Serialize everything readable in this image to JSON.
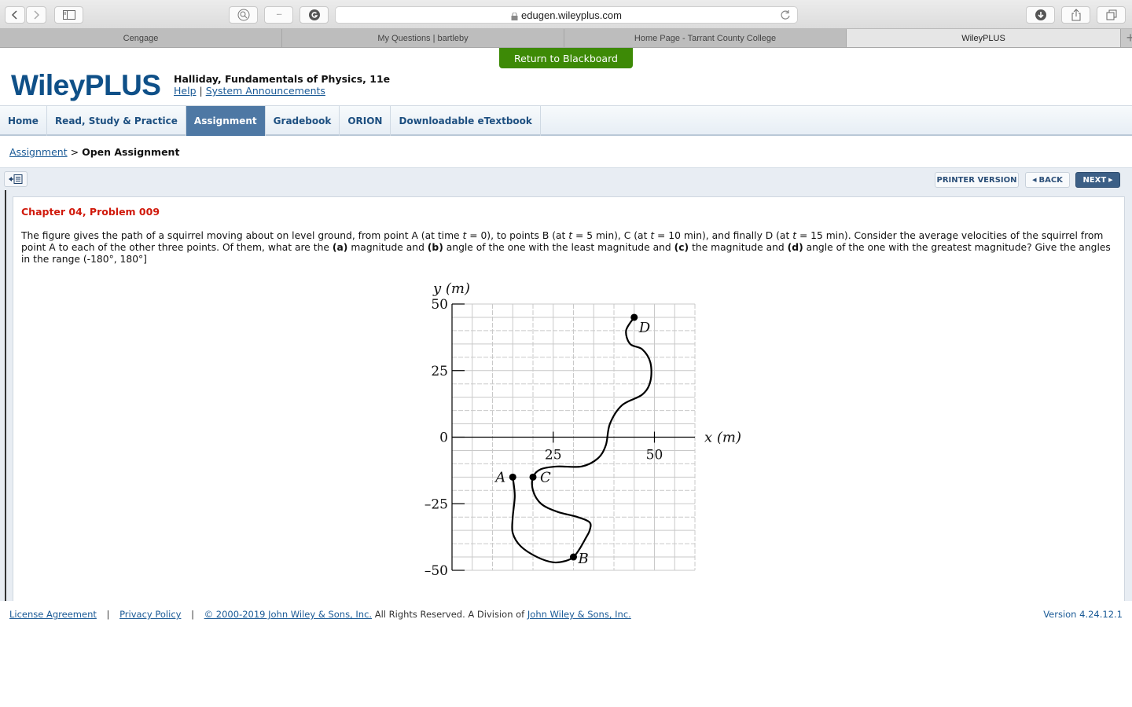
{
  "browser": {
    "url": "edugen.wileyplus.com",
    "tabs": [
      {
        "label": "Cengage",
        "active": false
      },
      {
        "label": "My Questions | bartleby",
        "active": false
      },
      {
        "label": "Home Page - Tarrant County College",
        "active": false
      },
      {
        "label": "WileyPLUS",
        "active": true
      }
    ],
    "new_tab_label": "+",
    "more_label": "···"
  },
  "page": {
    "return_button": "Return to Blackboard",
    "logo": "WileyPLUS",
    "course_title": "Halliday, Fundamentals of Physics, 11e",
    "help_link": "Help",
    "help_sep": "|",
    "announcements_link": "System Announcements",
    "nav": [
      {
        "label": "Home",
        "active": false
      },
      {
        "label": "Read, Study & Practice",
        "active": false
      },
      {
        "label": "Assignment",
        "active": true
      },
      {
        "label": "Gradebook",
        "active": false
      },
      {
        "label": "ORION",
        "active": false
      },
      {
        "label": "Downloadable eTextbook",
        "active": false
      }
    ],
    "breadcrumb": {
      "link": "Assignment",
      "sep": ">",
      "current": "Open Assignment"
    },
    "actions": {
      "printer": "PRINTER VERSION",
      "back": "BACK",
      "next": "NEXT"
    },
    "problem": {
      "title": "Chapter 04, Problem 009",
      "text_parts": [
        {
          "t": "The figure gives the path of a squirrel moving about on level ground, from point A (at time "
        },
        {
          "i": "t"
        },
        {
          "t": " = 0), to points B (at "
        },
        {
          "i": "t"
        },
        {
          "t": " = 5 min), C (at "
        },
        {
          "i": "t"
        },
        {
          "t": " = 10 min), and finally D (at "
        },
        {
          "i": "t"
        },
        {
          "t": " = 15 min). Consider the average velocities of the squirrel from point A to each of the other three points. Of them, what are the "
        },
        {
          "b": "(a)"
        },
        {
          "t": " magnitude and "
        },
        {
          "b": "(b)"
        },
        {
          "t": " angle of the one with the least magnitude and "
        },
        {
          "b": "(c)"
        },
        {
          "t": " the magnitude and "
        },
        {
          "b": "(d)"
        },
        {
          "t": " angle of the one with the greatest magnitude? Give the angles in the range (-180°, 180°]"
        }
      ]
    },
    "footer": {
      "license": "License Agreement",
      "privacy": "Privacy Policy",
      "sep": "|",
      "copyright_link": "© 2000-2019 John Wiley & Sons, Inc.",
      "rights": " All Rights Reserved. A Division of ",
      "division_link": "John Wiley & Sons, Inc.",
      "version": "Version 4.24.12.1"
    }
  },
  "chart_data": {
    "type": "line",
    "title": "",
    "xlabel": "x (m)",
    "ylabel": "y (m)",
    "xlim": [
      0,
      60
    ],
    "ylim": [
      -50,
      50
    ],
    "x_ticks": [
      {
        "value": 25,
        "label": "25"
      },
      {
        "value": 50,
        "label": "50"
      }
    ],
    "y_ticks": [
      {
        "value": 50,
        "label": "50"
      },
      {
        "value": 25,
        "label": "25"
      },
      {
        "value": 0,
        "label": "0"
      },
      {
        "value": -25,
        "label": "–25"
      },
      {
        "value": -50,
        "label": "–50"
      }
    ],
    "grid": true,
    "grid_step": 5,
    "points": [
      {
        "label": "A",
        "x": 15,
        "y": -15
      },
      {
        "label": "B",
        "x": 30,
        "y": -45
      },
      {
        "label": "C",
        "x": 20,
        "y": -15
      },
      {
        "label": "D",
        "x": 45,
        "y": 45
      }
    ],
    "path": [
      [
        15,
        -15
      ],
      [
        15.5,
        -22
      ],
      [
        15,
        -30
      ],
      [
        15,
        -36
      ],
      [
        17,
        -41
      ],
      [
        21,
        -45
      ],
      [
        25,
        -47
      ],
      [
        28,
        -46.5
      ],
      [
        30,
        -45
      ],
      [
        31.5,
        -42
      ],
      [
        33,
        -38
      ],
      [
        34,
        -35
      ],
      [
        34,
        -32
      ],
      [
        31,
        -30
      ],
      [
        26,
        -28
      ],
      [
        22,
        -25
      ],
      [
        20,
        -20
      ],
      [
        20,
        -15
      ],
      [
        22,
        -12
      ],
      [
        26,
        -11
      ],
      [
        32,
        -11
      ],
      [
        36,
        -8
      ],
      [
        38,
        -3
      ],
      [
        39,
        5
      ],
      [
        42,
        12
      ],
      [
        47,
        16
      ],
      [
        49,
        21
      ],
      [
        49,
        28
      ],
      [
        47,
        33
      ],
      [
        44,
        35
      ],
      [
        43,
        40
      ],
      [
        45,
        45
      ]
    ]
  }
}
